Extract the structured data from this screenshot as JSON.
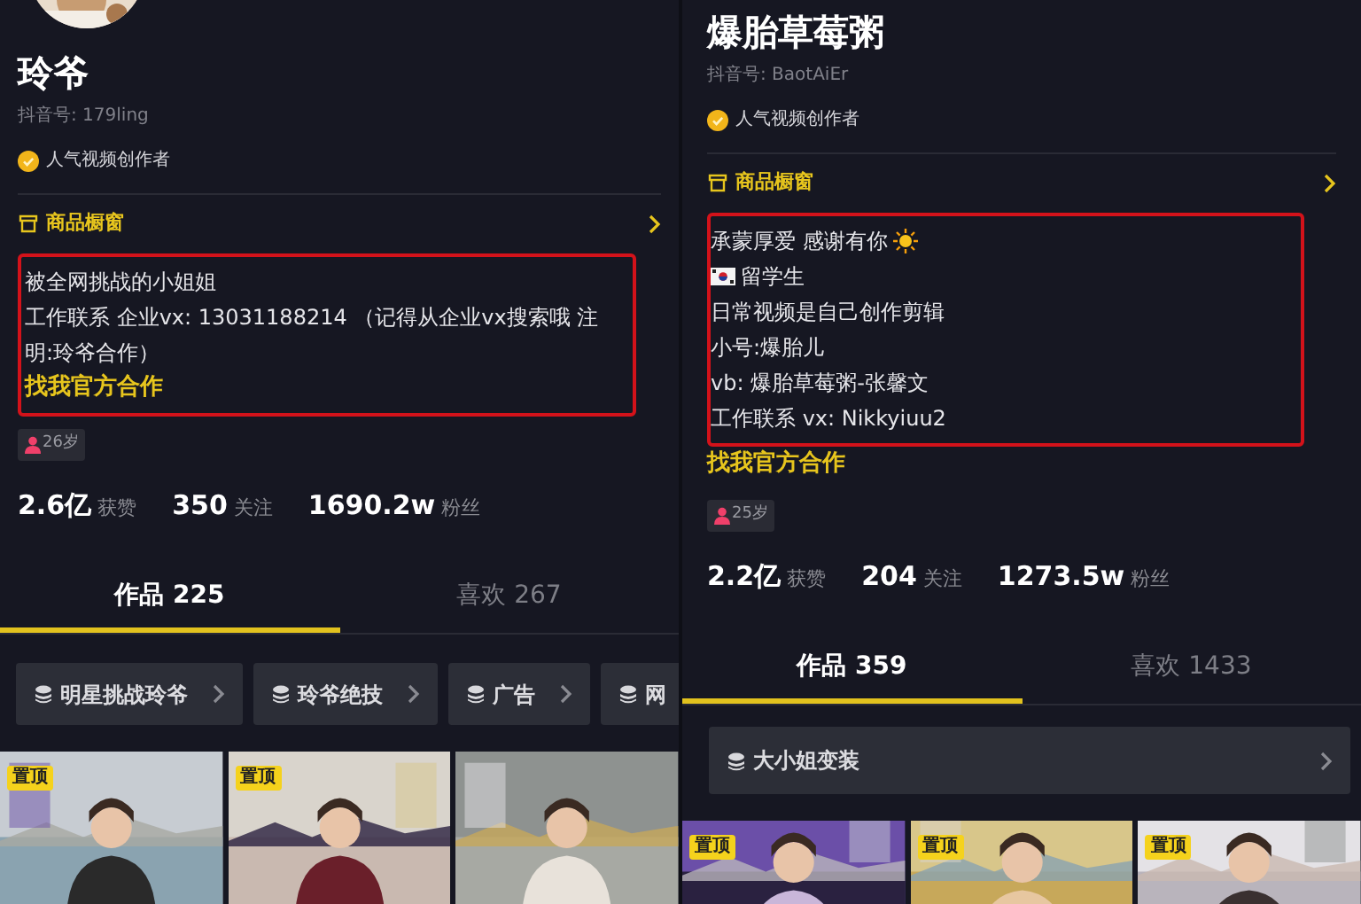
{
  "panels": [
    {
      "avatar": {
        "kind": "picture"
      },
      "name": "玲爷",
      "douyin_id": "抖音号: 179ling",
      "badge": "人气视频创作者",
      "shop": "商品橱窗",
      "bio": [
        {
          "kind": "text",
          "text": "被全网挑战的小姐姐"
        },
        {
          "kind": "text",
          "text": "工作联系 企业vx: 13031188214 （记得从企业vx搜索哦 注明:玲爷合作）"
        }
      ],
      "cooperation_link": {
        "text": "找我官方合作",
        "in_box": true
      },
      "age": "26岁",
      "stats": [
        "**2.6亿** 获赞",
        "**350** 关注",
        "**1690.2w** 粉丝"
      ],
      "tabs": [
        {
          "label": "作品 225",
          "selected": true
        },
        {
          "label": "喜欢 267",
          "selected": false
        }
      ],
      "collections": [
        "明星挑战玲爷",
        "玲爷绝技",
        "广告",
        "网"
      ],
      "videos": [
        {
          "pinned": true,
          "tag": "置顶"
        },
        {
          "pinned": true,
          "tag": "置顶"
        },
        {
          "pinned": false
        }
      ]
    },
    {
      "name": "爆胎草莓粥",
      "douyin_id": "抖音号: BaotAiEr",
      "badge": "人气视频创作者",
      "shop": "商品橱窗",
      "bio": [
        {
          "kind": "sun",
          "text": "承蒙厚爱 感谢有你"
        },
        {
          "kind": "flag",
          "text": "留学生"
        },
        {
          "kind": "text",
          "text": "日常视频是自己创作剪辑"
        },
        {
          "kind": "text",
          "text": "小号:爆胎儿"
        },
        {
          "kind": "text",
          "text": "vb: 爆胎草莓粥-张馨文"
        },
        {
          "kind": "text",
          "text": "工作联系 vx: Nikkyiuu2"
        }
      ],
      "cooperation_link": {
        "text": "找我官方合作",
        "in_box": false
      },
      "age": "25岁",
      "stats": [
        "**2.2亿** 获赞",
        "**204** 关注",
        "**1273.5w** 粉丝"
      ],
      "tabs": [
        {
          "label": "作品 359",
          "selected": true
        },
        {
          "label": "喜欢 1433",
          "selected": false
        }
      ],
      "collections": [
        "大小姐变装"
      ],
      "videos": [
        {
          "pinned": true,
          "tag": "置顶"
        },
        {
          "pinned": true,
          "tag": "置顶"
        },
        {
          "pinned": true,
          "tag": "置顶"
        }
      ]
    }
  ]
}
